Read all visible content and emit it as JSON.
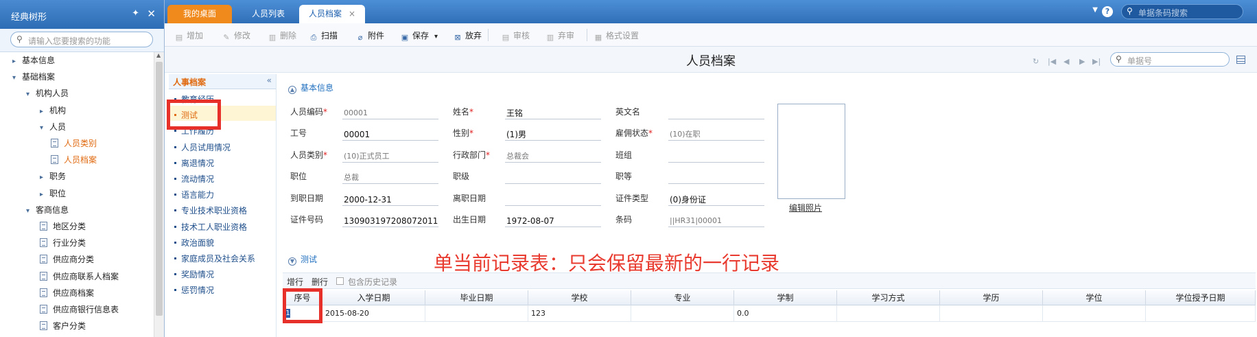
{
  "left_panel": {
    "title": "经典树形",
    "pin_icon": "pin-icon",
    "close_icon": "close-icon",
    "search_placeholder": "请输入您要搜索的功能",
    "tree": [
      {
        "label": "基本信息",
        "level": 0,
        "arrow": "›"
      },
      {
        "label": "基础档案",
        "level": 0,
        "arrow": "⌄"
      },
      {
        "label": "机构人员",
        "level": 1,
        "arrow": "⌄"
      },
      {
        "label": "机构",
        "level": 2,
        "arrow": "›"
      },
      {
        "label": "人员",
        "level": 2,
        "arrow": "⌄"
      },
      {
        "label": "人员类别",
        "level": 3,
        "arrow": "",
        "selected": true
      },
      {
        "label": "人员档案",
        "level": 3,
        "arrow": "",
        "selected": true
      },
      {
        "label": "职务",
        "level": 2,
        "arrow": "›"
      },
      {
        "label": "职位",
        "level": 2,
        "arrow": "›"
      },
      {
        "label": "客商信息",
        "level": 1,
        "arrow": "⌄"
      },
      {
        "label": "地区分类",
        "level": 2,
        "arrow": ""
      },
      {
        "label": "行业分类",
        "level": 2,
        "arrow": ""
      },
      {
        "label": "供应商分类",
        "level": 2,
        "arrow": ""
      },
      {
        "label": "供应商联系人档案",
        "level": 2,
        "arrow": ""
      },
      {
        "label": "供应商档案",
        "level": 2,
        "arrow": ""
      },
      {
        "label": "供应商银行信息表",
        "level": 2,
        "arrow": ""
      },
      {
        "label": "客户分类",
        "level": 2,
        "arrow": ""
      }
    ]
  },
  "tabs": [
    {
      "label": "我的桌面",
      "kind": "home"
    },
    {
      "label": "人员列表",
      "kind": "normal"
    },
    {
      "label": "人员档案",
      "kind": "active",
      "close": "×"
    }
  ],
  "top_search_placeholder": "单据条码搜索",
  "help_icon_text": "?",
  "toolbar": [
    {
      "label": "增加",
      "enabled": false,
      "icon": "add-icon",
      "glyph": "▤"
    },
    {
      "label": "修改",
      "enabled": false,
      "icon": "edit-icon",
      "glyph": "✎"
    },
    {
      "label": "删除",
      "enabled": false,
      "icon": "delete-icon",
      "glyph": "▥"
    },
    {
      "label": "扫描",
      "enabled": true,
      "icon": "scan-icon",
      "glyph": "⎙"
    },
    {
      "label": "附件",
      "enabled": true,
      "icon": "attachment-icon",
      "glyph": "⌀"
    },
    {
      "label": "保存",
      "enabled": true,
      "icon": "save-icon",
      "glyph": "▣",
      "dropdown": "▾"
    },
    {
      "label": "放弃",
      "enabled": true,
      "icon": "discard-icon",
      "glyph": "⊠"
    },
    {
      "label": "审核",
      "enabled": false,
      "icon": "audit-icon",
      "glyph": "▤"
    },
    {
      "label": "弃审",
      "enabled": false,
      "icon": "unaudit-icon",
      "glyph": "▥"
    },
    {
      "label": "格式设置",
      "enabled": false,
      "icon": "format-icon",
      "glyph": "▦"
    }
  ],
  "page_title": "人员档案",
  "record_search_placeholder": "单据号",
  "sub_panel": {
    "title": "人事档案",
    "collapse": "«",
    "items": [
      {
        "label": "教育经历"
      },
      {
        "label": "测试",
        "selected": true
      },
      {
        "label": "工作履历"
      },
      {
        "label": "人员试用情况"
      },
      {
        "label": "离退情况"
      },
      {
        "label": "流动情况"
      },
      {
        "label": "语言能力"
      },
      {
        "label": "专业技术职业资格"
      },
      {
        "label": "技术工人职业资格"
      },
      {
        "label": "政治面貌"
      },
      {
        "label": "家庭成员及社会关系"
      },
      {
        "label": "奖励情况"
      },
      {
        "label": "惩罚情况"
      }
    ]
  },
  "form": {
    "section_basic": "基本信息",
    "section_detail": "测试",
    "fields": [
      {
        "label": "人员编码",
        "required": true,
        "value": "00001",
        "style": "gray",
        "col": 0,
        "row": 0
      },
      {
        "label": "姓名",
        "required": true,
        "value": "王铭",
        "style": "dark",
        "col": 1,
        "row": 0
      },
      {
        "label": "英文名",
        "required": false,
        "value": "",
        "style": "dark",
        "col": 2,
        "row": 0
      },
      {
        "label": "工号",
        "required": false,
        "value": "00001",
        "style": "dark",
        "col": 0,
        "row": 1
      },
      {
        "label": "性别",
        "required": true,
        "value": "(1)男",
        "style": "dark",
        "col": 1,
        "row": 1
      },
      {
        "label": "雇佣状态",
        "required": true,
        "value": "(10)在职",
        "style": "gray",
        "col": 2,
        "row": 1
      },
      {
        "label": "人员类别",
        "required": true,
        "value": "(10)正式员工",
        "style": "gray",
        "col": 0,
        "row": 2
      },
      {
        "label": "行政部门",
        "required": true,
        "value": "总裁会",
        "style": "gray",
        "col": 1,
        "row": 2
      },
      {
        "label": "班组",
        "required": false,
        "value": "",
        "style": "dark",
        "col": 2,
        "row": 2
      },
      {
        "label": "职位",
        "required": false,
        "value": "总裁",
        "style": "gray",
        "col": 0,
        "row": 3
      },
      {
        "label": "职级",
        "required": false,
        "value": "",
        "style": "dark",
        "col": 1,
        "row": 3
      },
      {
        "label": "职等",
        "required": false,
        "value": "",
        "style": "dark",
        "col": 2,
        "row": 3
      },
      {
        "label": "到职日期",
        "required": false,
        "value": "2000-12-31",
        "style": "dark",
        "col": 0,
        "row": 4
      },
      {
        "label": "离职日期",
        "required": false,
        "value": "",
        "style": "dark",
        "col": 1,
        "row": 4
      },
      {
        "label": "证件类型",
        "required": false,
        "value": "(0)身份证",
        "style": "dark",
        "col": 2,
        "row": 4
      },
      {
        "label": "证件号码",
        "required": false,
        "value": "130903197208072011",
        "style": "dark",
        "col": 0,
        "row": 5
      },
      {
        "label": "出生日期",
        "required": false,
        "value": "1972-08-07",
        "style": "dark",
        "col": 1,
        "row": 5
      },
      {
        "label": "条码",
        "required": false,
        "value": "||HR31|00001",
        "style": "gray",
        "col": 2,
        "row": 5
      }
    ],
    "edit_photo": "编辑照片"
  },
  "annotation_text": "单当前记录表：只会保留最新的一行记录",
  "detail_grid": {
    "add_row": "增行",
    "delete_row": "删行",
    "history_checkbox": "包含历史记录",
    "columns": [
      "序号",
      "入学日期",
      "毕业日期",
      "学校",
      "专业",
      "学制",
      "学习方式",
      "学历",
      "学位",
      "学位授予日期"
    ],
    "rows": [
      [
        "1",
        "2015-08-20",
        "",
        "123",
        "",
        "0.0",
        "",
        "",
        "",
        ""
      ]
    ]
  }
}
